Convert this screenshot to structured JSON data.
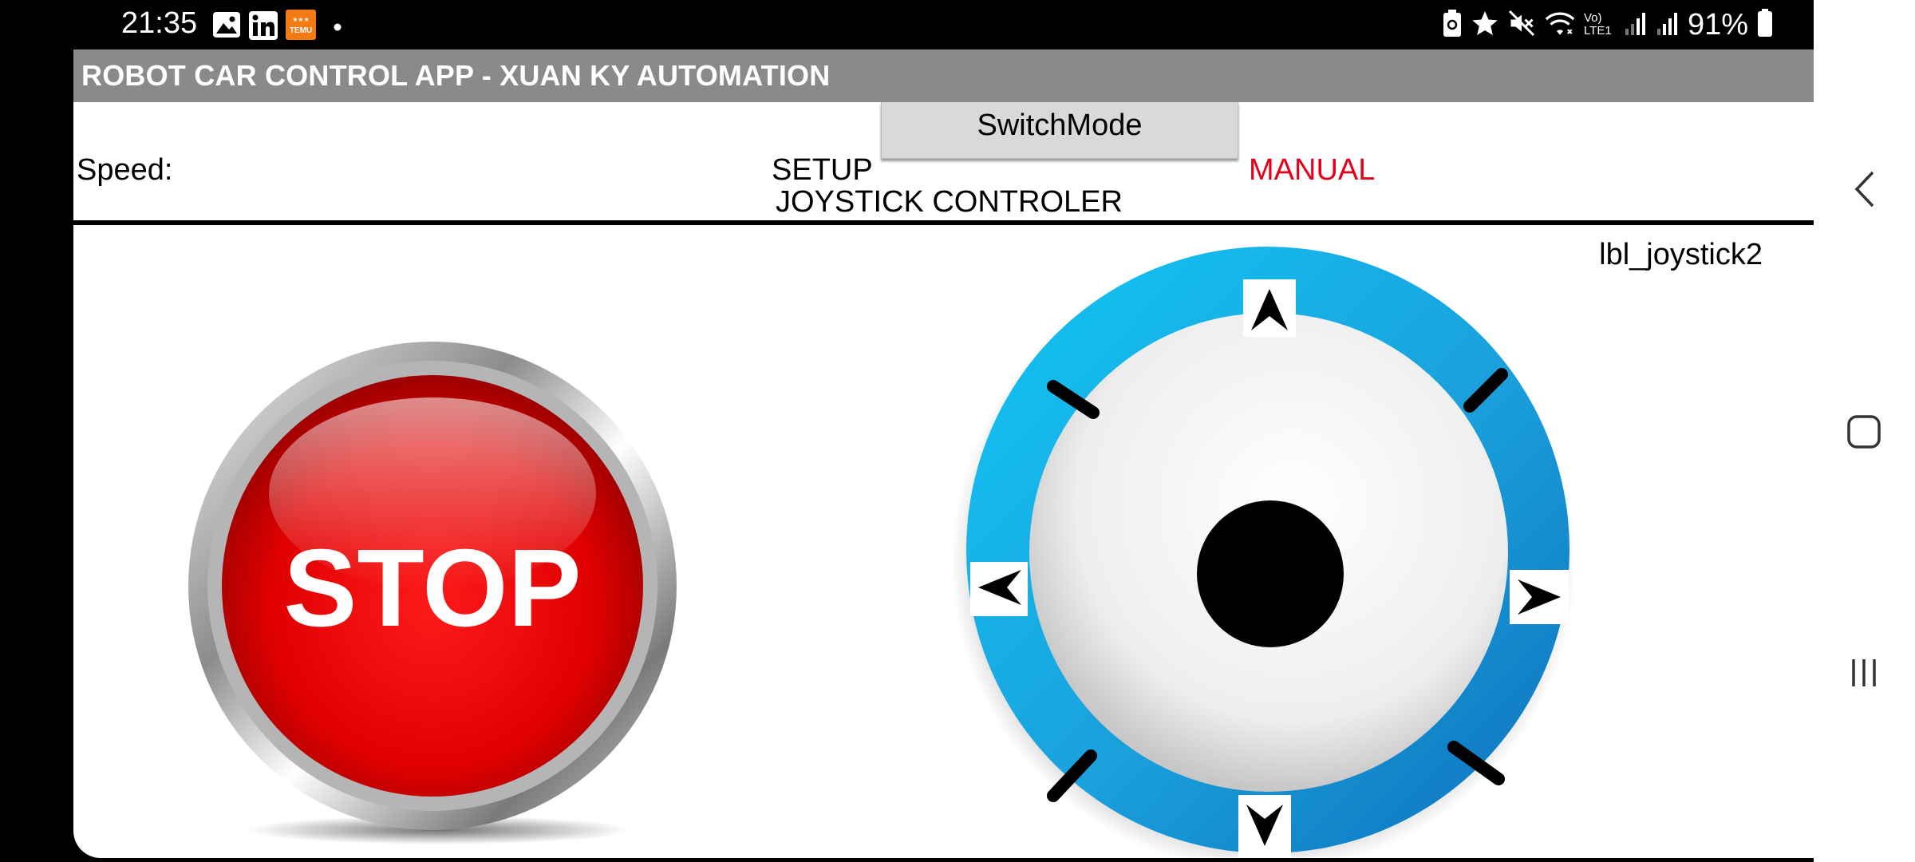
{
  "status_bar": {
    "time": "21:35",
    "battery_percent": "91%",
    "network_label": "Vo) LTE1",
    "notification_icons": [
      "gallery-icon",
      "linkedin-icon",
      "temu-icon",
      "dot-icon"
    ],
    "status_icons": [
      "battery-saver-icon",
      "star-icon",
      "mute-icon",
      "wifi-icon",
      "signal-icon",
      "signal-icon",
      "battery-icon"
    ],
    "temu_label": "TEMU"
  },
  "app": {
    "title": "ROBOT CAR CONTROL APP - XUAN KY AUTOMATION",
    "speed_label": "Speed:",
    "setup_label": "SETUP",
    "switch_button_label": "SwitchMode",
    "mode_value": "MANUAL",
    "joystick_title": "JOYSTICK CONTROLER",
    "joystick_label": "lbl_joystick2",
    "stop_button_label": "STOP",
    "colors": {
      "title_bar": "#8a8a8a",
      "mode_text": "#e4001a",
      "stop_red": "#e30000",
      "joystick_ring": "#13a8e0"
    }
  },
  "nav_bar": {
    "buttons": [
      "back-icon",
      "home-icon",
      "recents-icon"
    ]
  }
}
